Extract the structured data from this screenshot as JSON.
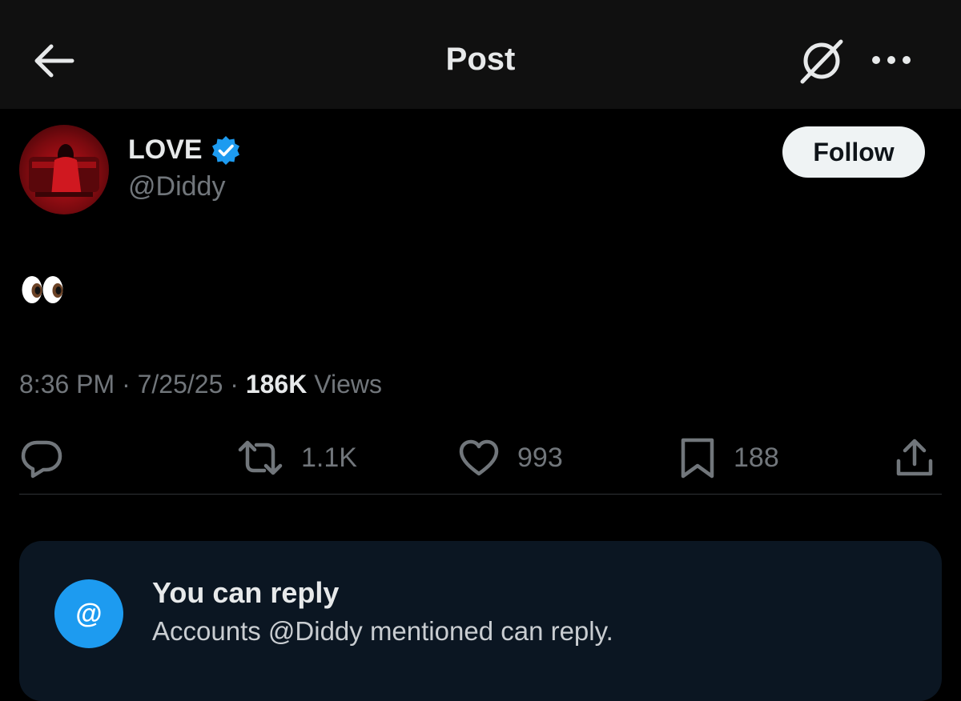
{
  "header": {
    "title": "Post",
    "back_icon": "arrow-left-icon",
    "grok_icon": "grok-icon",
    "more_icon": "more-dots-icon"
  },
  "author": {
    "display_name": "LOVE",
    "handle": "@Diddy",
    "verified": true,
    "verified_color": "#1d9bf0",
    "follow_label": "Follow"
  },
  "post": {
    "text": "👀",
    "time": "8:36 PM",
    "separator": " · ",
    "date": "7/25/25",
    "views_count": "186K",
    "views_label": " Views"
  },
  "actions": {
    "reply": {
      "icon": "reply-icon"
    },
    "repost": {
      "icon": "repost-icon",
      "count": "1.1K"
    },
    "like": {
      "icon": "heart-icon",
      "count": "993"
    },
    "bookmark": {
      "icon": "bookmark-icon",
      "count": "188"
    },
    "share": {
      "icon": "share-icon"
    }
  },
  "reply_notice": {
    "icon_text": "@",
    "title": "You can reply",
    "subtitle": "Accounts @Diddy mentioned can reply."
  },
  "colors": {
    "background": "#000000",
    "header_background": "#101010",
    "accent": "#1d9bf0",
    "muted_text": "#71767b",
    "card_background": "#0b1622"
  }
}
